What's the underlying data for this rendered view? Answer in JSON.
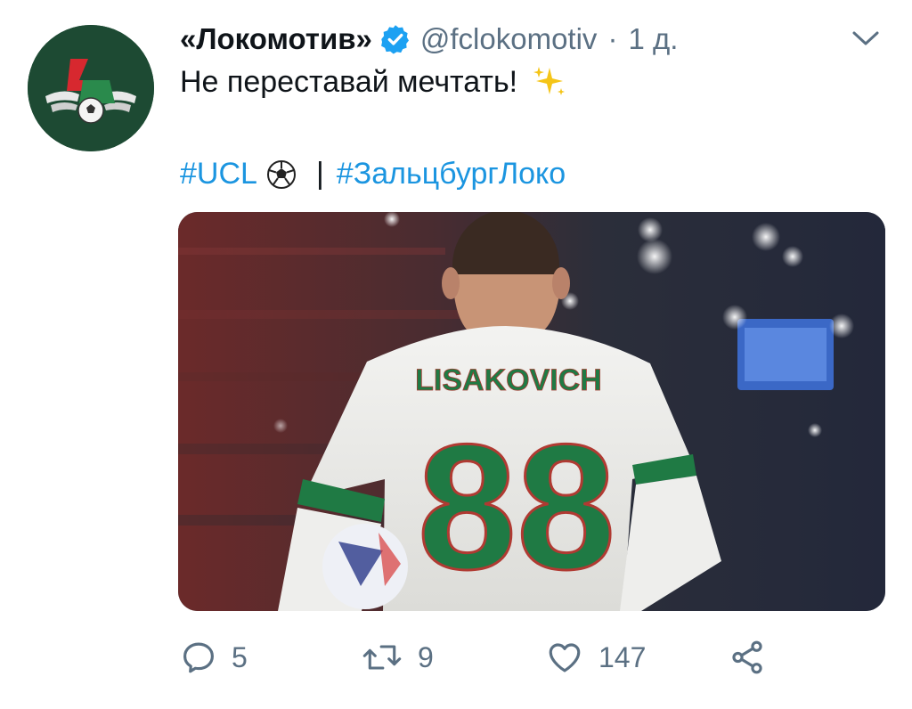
{
  "tweet": {
    "display_name": "«Локомотив»",
    "handle": "@fclokomotiv",
    "separator": "·",
    "time": "1 д.",
    "text": "Не переставай мечтать!",
    "hashtags": [
      "#UCL",
      "#ЗальцбургЛоко"
    ],
    "hashtag_separator": "|",
    "media": {
      "shirt_name": "LISAKOVICH",
      "shirt_number": "88"
    },
    "actions": {
      "reply_count": "5",
      "retweet_count": "9",
      "like_count": "147"
    }
  },
  "colors": {
    "accent": "#1b95e0",
    "muted": "#5b7083",
    "avatar_bg": "#1d4a33",
    "logo_red": "#d7282f",
    "kit_green": "#1f7a44"
  },
  "icons": {
    "verified": "verified-badge-icon",
    "caret": "chevron-down-icon",
    "sparkle": "sparkles-emoji-icon",
    "ball": "soccer-ball-emoji-icon",
    "reply": "reply-icon",
    "retweet": "retweet-icon",
    "like": "heart-icon",
    "share": "share-icon"
  }
}
